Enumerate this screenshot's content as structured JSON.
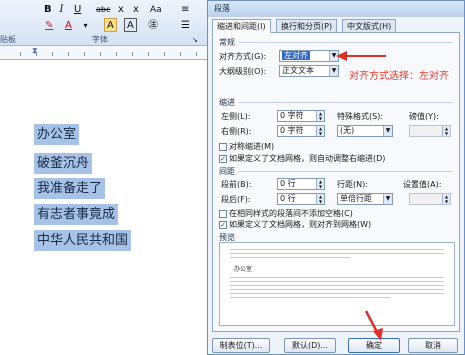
{
  "ribbon": {
    "buttons": {
      "bold": "B",
      "italic": "I",
      "underline": "U",
      "abc": "abc",
      "xsub": "x",
      "xsup": "x",
      "aa": "Aa",
      "font_color": "A",
      "char_border": "A",
      "pinyin": "A"
    },
    "left_label": "贴板",
    "font_group_label": "字体",
    "para_group_label": "段落"
  },
  "document": {
    "lines": [
      "办公室",
      "破釜沉舟",
      "我准备走了",
      "有志者事竟成",
      "中华人民共和国"
    ]
  },
  "dialog": {
    "title": "段落",
    "tabs": [
      "缩进和间距(I)",
      "换行和分页(P)",
      "中文版式(H)"
    ],
    "general": {
      "section": "常规",
      "alignment_label": "对齐方式(G):",
      "alignment_value": "左对齐",
      "outline_label": "大纲级别(O):",
      "outline_value": "正文文本"
    },
    "indent": {
      "section": "缩进",
      "left_label": "左侧(L):",
      "left_value": "0 字符",
      "right_label": "右侧(R):",
      "right_value": "0 字符",
      "special_label": "特殊格式(S):",
      "special_value": "(无)",
      "by_label": "磅值(Y):",
      "by_value": "",
      "mirror_label": "对称缩进(M)",
      "auto_adjust_label": "如果定义了文档网格，则自动调整右缩进(D)"
    },
    "spacing": {
      "section": "间距",
      "before_label": "段前(B):",
      "before_value": "0 行",
      "after_label": "段后(F):",
      "after_value": "0 行",
      "line_label": "行距(N):",
      "line_value": "单倍行距",
      "at_label": "设置值(A):",
      "at_value": "",
      "no_space_label": "在相同样式的段落间不添加空格(C)",
      "snap_grid_label": "如果定义了文档网格，则对齐到网格(W)"
    },
    "preview": {
      "section": "预览",
      "sample_text": "办公室"
    },
    "buttons": {
      "tabs": "制表位(T)...",
      "default": "默认(D)...",
      "ok": "确定",
      "cancel": "取消"
    }
  },
  "annotation": {
    "text": "对齐方式选择：左对齐",
    "color": "#e03a2a"
  }
}
